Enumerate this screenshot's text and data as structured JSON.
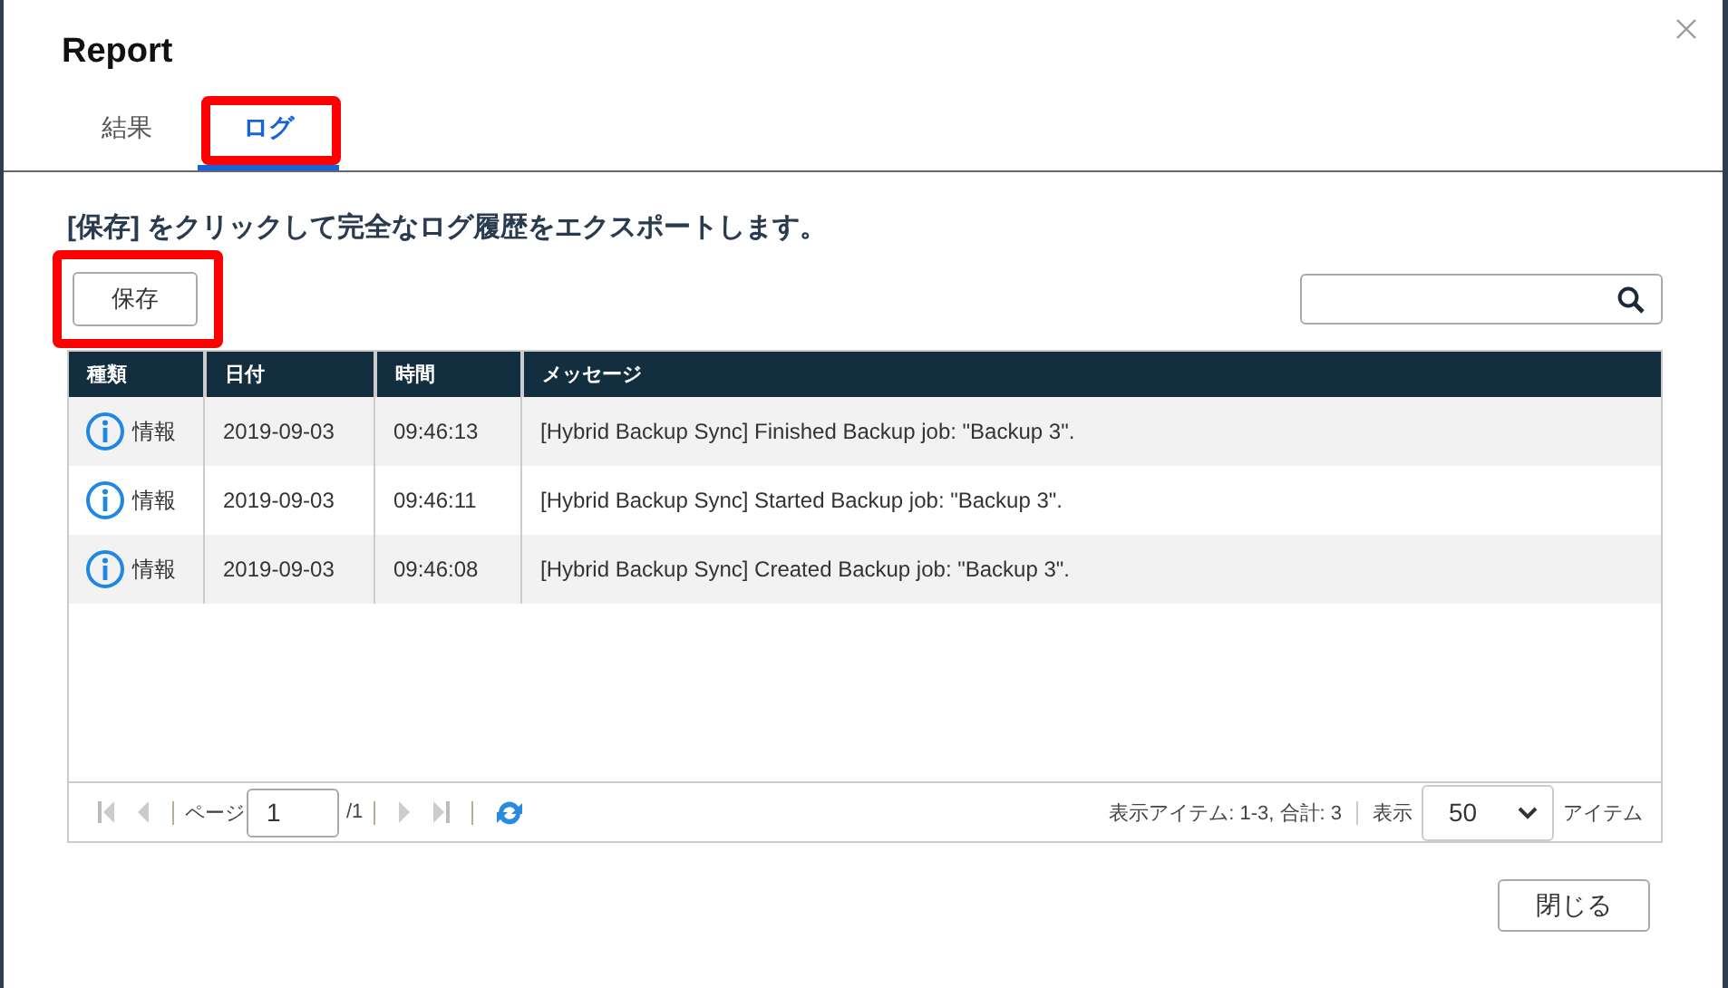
{
  "window": {
    "title": "Report"
  },
  "tabs": [
    {
      "label": "結果",
      "selected": false,
      "highlighted": false
    },
    {
      "label": "ログ",
      "selected": true,
      "highlighted": true
    }
  ],
  "instruction": "[保存] をクリックして完全なログ履歴をエクスポートします。",
  "save_button": {
    "label": "保存",
    "highlighted": true
  },
  "table": {
    "columns": [
      "種類",
      "日付",
      "時間",
      "メッセージ"
    ],
    "rows": [
      {
        "type": "情報",
        "date": "2019-09-03",
        "time": "09:46:13",
        "message": "[Hybrid Backup Sync] Finished Backup job: \"Backup 3\"."
      },
      {
        "type": "情報",
        "date": "2019-09-03",
        "time": "09:46:11",
        "message": "[Hybrid Backup Sync] Started Backup job: \"Backup 3\"."
      },
      {
        "type": "情報",
        "date": "2019-09-03",
        "time": "09:46:08",
        "message": "[Hybrid Backup Sync] Created Backup job: \"Backup 3\"."
      }
    ]
  },
  "pager": {
    "page_label": "ページ",
    "page": "1",
    "total_pages": "/1",
    "summary": "表示アイテム: 1-3, 合計: 3",
    "show_label": "表示",
    "per_page": "50",
    "items_label": "アイテム"
  },
  "buttons": [
    {
      "label": "閉じる"
    }
  ]
}
